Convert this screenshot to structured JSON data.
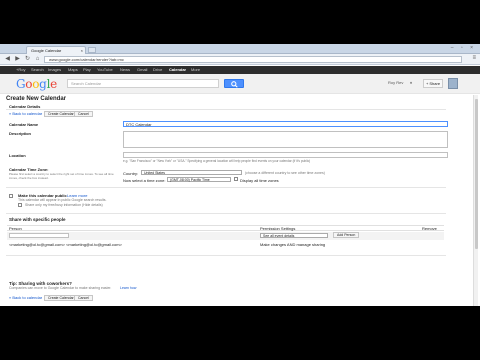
{
  "browser": {
    "tab_title": "Google Calendar",
    "url": "www.google.com/calendar/render?tab=mc"
  },
  "gbar": {
    "items": [
      "+Roy",
      "Search",
      "Images",
      "Maps",
      "Play",
      "YouTube",
      "News",
      "Gmail",
      "Drive",
      "Calendar",
      "More"
    ],
    "active": "Calendar"
  },
  "header": {
    "logo_letters": [
      {
        "ch": "G",
        "color": "#4285f4"
      },
      {
        "ch": "o",
        "color": "#ea4335"
      },
      {
        "ch": "o",
        "color": "#fbbc05"
      },
      {
        "ch": "g",
        "color": "#4285f4"
      },
      {
        "ch": "l",
        "color": "#34a853"
      },
      {
        "ch": "e",
        "color": "#ea4335"
      }
    ],
    "search_placeholder": "Search Calendar",
    "user_name": "Roy Rev",
    "share_label": "+ Share"
  },
  "page": {
    "title": "Create New Calendar",
    "section_details": "Calendar Details",
    "back_link": "« Back to calendar",
    "create_button": "Create Calendar",
    "cancel_button": "Cancel",
    "name_label": "Calendar Name",
    "name_value": "DTC Calendar",
    "description_label": "Description",
    "location_label": "Location",
    "location_hint": "e.g. \"San Francisco\" or \"New York\" or \"USA.\" Specifying a general location will help people find events on your calendar (if it's public)",
    "timezone_label": "Calendar Time Zone:",
    "timezone_help": "Please first select a country to select the right set of time zones. To see all time zones, check the box instead.",
    "country_label": "Country:",
    "country_value": "United States",
    "country_hint": "(choose a different country to see other time zones)",
    "tz_label": "Now select a time zone:",
    "tz_value": "(GMT-08:00) Pacific Time",
    "display_all_label": "Display all time zones",
    "make_public_label": "Make this calendar public",
    "learn_more": "Learn more",
    "public_note": "This calendar will appear in public Google search results.",
    "freebusy_label": "Share only my free/busy information (Hide details)",
    "share_heading": "Share with specific people",
    "col_person": "Person",
    "col_permission": "Permission Settings",
    "col_remove": "Remove",
    "add_permission_value": "See all event details",
    "add_person_button": "Add Person",
    "shared_email": "marketing@ol.tc",
    "shared_email_full": "<marketing@ol.tc@gmail.com> <marketing@ol.tc@gmail.com>",
    "shared_permission": "Make changes AND manage sharing",
    "tip_heading": "Tip: Sharing with coworkers?",
    "tip_text": "Companies can move to Google Calendar to make sharing easier.",
    "tip_link": "Learn how",
    "bottom_back": "« Back to calendar",
    "bottom_create": "Create Calendar",
    "bottom_cancel": "Cancel"
  }
}
